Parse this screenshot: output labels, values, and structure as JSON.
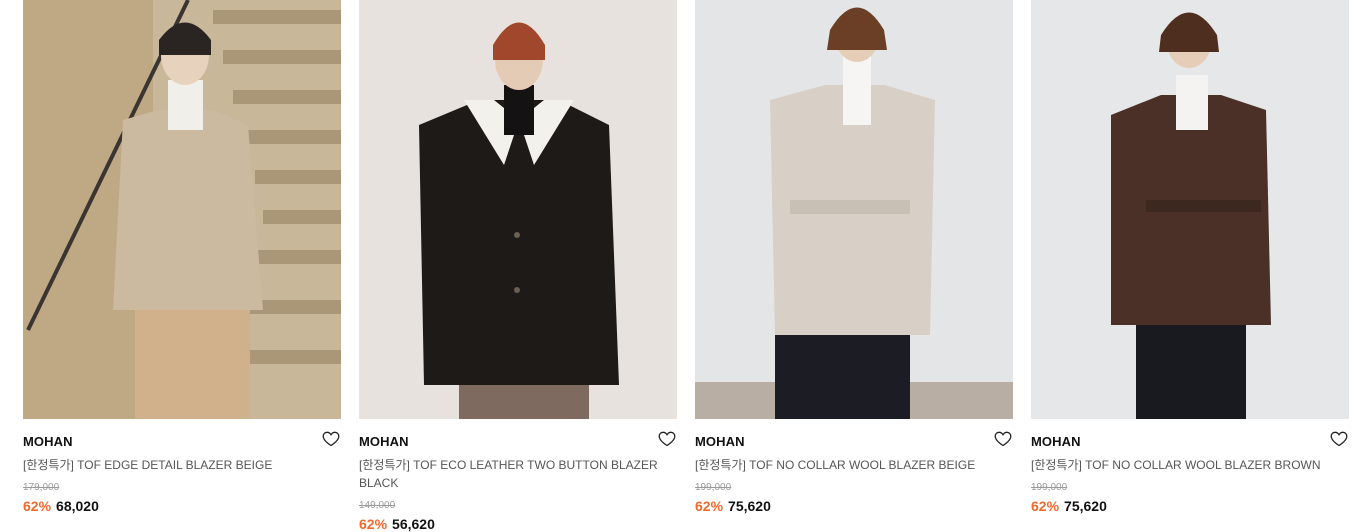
{
  "products": [
    {
      "brand": "MOHAN",
      "name": "[한정특가] TOF EDGE DETAIL BLAZER BEIGE",
      "original_price": "179,000",
      "discount": "62%",
      "price": "68,020",
      "wishlist_icon": "heart-outline-icon"
    },
    {
      "brand": "MOHAN",
      "name": "[한정특가] TOF ECO LEATHER TWO BUTTON BLAZER BLACK",
      "original_price": "149,000",
      "discount": "62%",
      "price": "56,620",
      "wishlist_icon": "heart-outline-icon"
    },
    {
      "brand": "MOHAN",
      "name": "[한정특가] TOF NO COLLAR WOOL BLAZER BEIGE",
      "original_price": "199,000",
      "discount": "62%",
      "price": "75,620",
      "wishlist_icon": "heart-outline-icon"
    },
    {
      "brand": "MOHAN",
      "name": "[한정특가] TOF NO COLLAR WOOL BLAZER BROWN",
      "original_price": "199,000",
      "discount": "62%",
      "price": "75,620",
      "wishlist_icon": "heart-outline-icon"
    }
  ],
  "colors": {
    "discount": "#ef6a2c",
    "text": "#111111",
    "muted": "#9a9a9a"
  }
}
